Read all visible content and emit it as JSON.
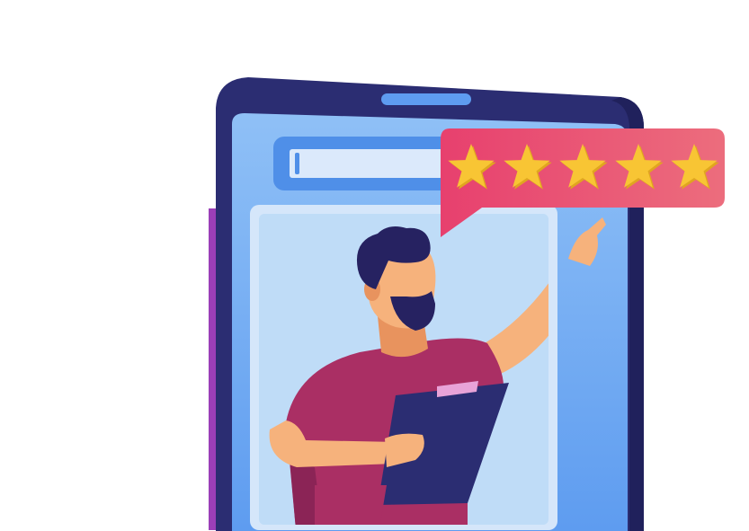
{
  "illustration": {
    "subject": "phone-review",
    "rating": {
      "stars_filled": 5,
      "stars_total": 5
    },
    "colors": {
      "phone_frame": "#2b2d72",
      "phone_frame_dark": "#20215c",
      "screen": "#5e9cf0",
      "screen_light": "#8fc0f6",
      "search_bar_frame": "#4f8fe8",
      "search_bar": "#dbe9fb",
      "photo_frame": "#d5e6fa",
      "photo_background": "#bfdcf7",
      "bubble_gradient_start": "#e7406e",
      "bubble_gradient_end": "#ec6d7d",
      "star": "#f8c534",
      "star_shadow": "#e0a61f",
      "shirt": "#aa2f64",
      "shirt_shadow": "#8b2456",
      "skin": "#f6b27c",
      "skin_shadow": "#e8935e",
      "hair": "#262261",
      "clipboard": "#2b2d72",
      "clipboard_clip": "#e8a3d8",
      "accent_purple": "#9b3fb8"
    }
  }
}
